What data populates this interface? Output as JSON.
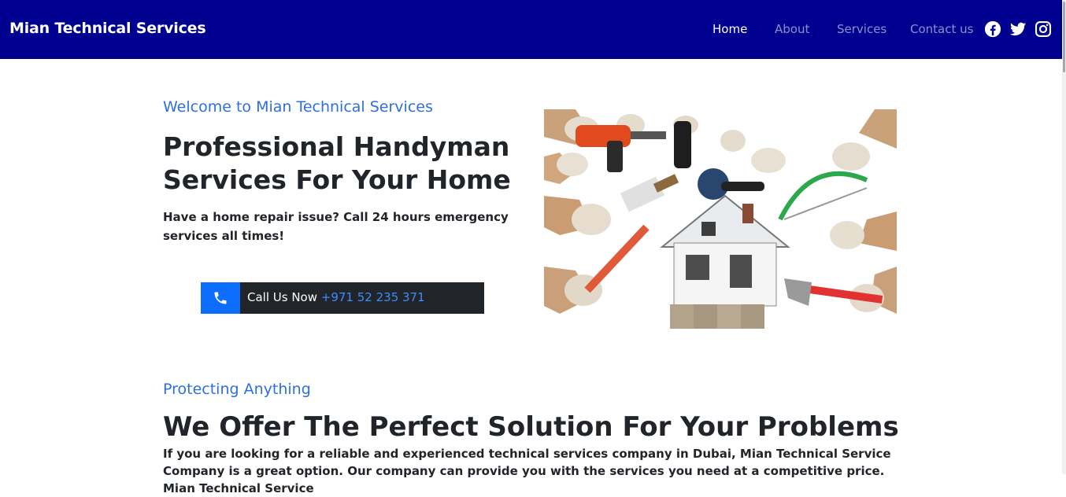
{
  "navbar": {
    "brand": "Mian Technical Services",
    "links": [
      {
        "label": "Home",
        "active": true
      },
      {
        "label": "About",
        "active": false
      },
      {
        "label": "Services",
        "active": false
      },
      {
        "label": "Contact us",
        "active": false
      }
    ],
    "social_icons": [
      "facebook-icon",
      "twitter-icon",
      "instagram-icon"
    ],
    "background_color": "#000090"
  },
  "hero": {
    "eyebrow": "Welcome to Mian Technical Services",
    "title": "Professional Handyman Services For Your Home",
    "subtitle": "Have a home repair issue? Call 24 hours emergency services all times!",
    "call_button": {
      "icon": "phone-icon",
      "label": "Call Us Now",
      "number": "+971 52 235 371"
    },
    "image_subject": "hands holding tools around a house"
  },
  "section": {
    "eyebrow": "Protecting Anything",
    "title": "We Offer The Perfect Solution For Your Problems",
    "text": "If you are looking for a reliable and experienced technical services company in Dubai, Mian Technical Service Company is a great option. Our company can provide you with the services you need at a competitive price. Mian Technical Service"
  },
  "colors": {
    "accent": "#2d6fe0",
    "button_primary": "#0d6efd",
    "button_dark": "#212529"
  }
}
